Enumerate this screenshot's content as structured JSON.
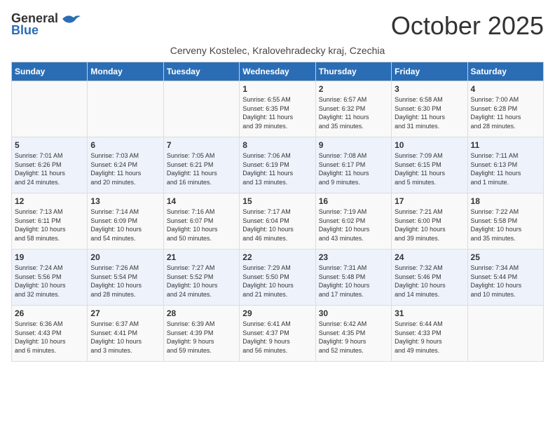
{
  "logo": {
    "general": "General",
    "blue": "Blue"
  },
  "title": "October 2025",
  "subtitle": "Cerveny Kostelec, Kralovehradecky kraj, Czechia",
  "days_of_week": [
    "Sunday",
    "Monday",
    "Tuesday",
    "Wednesday",
    "Thursday",
    "Friday",
    "Saturday"
  ],
  "weeks": [
    [
      {
        "day": "",
        "detail": ""
      },
      {
        "day": "",
        "detail": ""
      },
      {
        "day": "",
        "detail": ""
      },
      {
        "day": "1",
        "detail": "Sunrise: 6:55 AM\nSunset: 6:35 PM\nDaylight: 11 hours\nand 39 minutes."
      },
      {
        "day": "2",
        "detail": "Sunrise: 6:57 AM\nSunset: 6:32 PM\nDaylight: 11 hours\nand 35 minutes."
      },
      {
        "day": "3",
        "detail": "Sunrise: 6:58 AM\nSunset: 6:30 PM\nDaylight: 11 hours\nand 31 minutes."
      },
      {
        "day": "4",
        "detail": "Sunrise: 7:00 AM\nSunset: 6:28 PM\nDaylight: 11 hours\nand 28 minutes."
      }
    ],
    [
      {
        "day": "5",
        "detail": "Sunrise: 7:01 AM\nSunset: 6:26 PM\nDaylight: 11 hours\nand 24 minutes."
      },
      {
        "day": "6",
        "detail": "Sunrise: 7:03 AM\nSunset: 6:24 PM\nDaylight: 11 hours\nand 20 minutes."
      },
      {
        "day": "7",
        "detail": "Sunrise: 7:05 AM\nSunset: 6:21 PM\nDaylight: 11 hours\nand 16 minutes."
      },
      {
        "day": "8",
        "detail": "Sunrise: 7:06 AM\nSunset: 6:19 PM\nDaylight: 11 hours\nand 13 minutes."
      },
      {
        "day": "9",
        "detail": "Sunrise: 7:08 AM\nSunset: 6:17 PM\nDaylight: 11 hours\nand 9 minutes."
      },
      {
        "day": "10",
        "detail": "Sunrise: 7:09 AM\nSunset: 6:15 PM\nDaylight: 11 hours\nand 5 minutes."
      },
      {
        "day": "11",
        "detail": "Sunrise: 7:11 AM\nSunset: 6:13 PM\nDaylight: 11 hours\nand 1 minute."
      }
    ],
    [
      {
        "day": "12",
        "detail": "Sunrise: 7:13 AM\nSunset: 6:11 PM\nDaylight: 10 hours\nand 58 minutes."
      },
      {
        "day": "13",
        "detail": "Sunrise: 7:14 AM\nSunset: 6:09 PM\nDaylight: 10 hours\nand 54 minutes."
      },
      {
        "day": "14",
        "detail": "Sunrise: 7:16 AM\nSunset: 6:07 PM\nDaylight: 10 hours\nand 50 minutes."
      },
      {
        "day": "15",
        "detail": "Sunrise: 7:17 AM\nSunset: 6:04 PM\nDaylight: 10 hours\nand 46 minutes."
      },
      {
        "day": "16",
        "detail": "Sunrise: 7:19 AM\nSunset: 6:02 PM\nDaylight: 10 hours\nand 43 minutes."
      },
      {
        "day": "17",
        "detail": "Sunrise: 7:21 AM\nSunset: 6:00 PM\nDaylight: 10 hours\nand 39 minutes."
      },
      {
        "day": "18",
        "detail": "Sunrise: 7:22 AM\nSunset: 5:58 PM\nDaylight: 10 hours\nand 35 minutes."
      }
    ],
    [
      {
        "day": "19",
        "detail": "Sunrise: 7:24 AM\nSunset: 5:56 PM\nDaylight: 10 hours\nand 32 minutes."
      },
      {
        "day": "20",
        "detail": "Sunrise: 7:26 AM\nSunset: 5:54 PM\nDaylight: 10 hours\nand 28 minutes."
      },
      {
        "day": "21",
        "detail": "Sunrise: 7:27 AM\nSunset: 5:52 PM\nDaylight: 10 hours\nand 24 minutes."
      },
      {
        "day": "22",
        "detail": "Sunrise: 7:29 AM\nSunset: 5:50 PM\nDaylight: 10 hours\nand 21 minutes."
      },
      {
        "day": "23",
        "detail": "Sunrise: 7:31 AM\nSunset: 5:48 PM\nDaylight: 10 hours\nand 17 minutes."
      },
      {
        "day": "24",
        "detail": "Sunrise: 7:32 AM\nSunset: 5:46 PM\nDaylight: 10 hours\nand 14 minutes."
      },
      {
        "day": "25",
        "detail": "Sunrise: 7:34 AM\nSunset: 5:44 PM\nDaylight: 10 hours\nand 10 minutes."
      }
    ],
    [
      {
        "day": "26",
        "detail": "Sunrise: 6:36 AM\nSunset: 4:43 PM\nDaylight: 10 hours\nand 6 minutes."
      },
      {
        "day": "27",
        "detail": "Sunrise: 6:37 AM\nSunset: 4:41 PM\nDaylight: 10 hours\nand 3 minutes."
      },
      {
        "day": "28",
        "detail": "Sunrise: 6:39 AM\nSunset: 4:39 PM\nDaylight: 9 hours\nand 59 minutes."
      },
      {
        "day": "29",
        "detail": "Sunrise: 6:41 AM\nSunset: 4:37 PM\nDaylight: 9 hours\nand 56 minutes."
      },
      {
        "day": "30",
        "detail": "Sunrise: 6:42 AM\nSunset: 4:35 PM\nDaylight: 9 hours\nand 52 minutes."
      },
      {
        "day": "31",
        "detail": "Sunrise: 6:44 AM\nSunset: 4:33 PM\nDaylight: 9 hours\nand 49 minutes."
      },
      {
        "day": "",
        "detail": ""
      }
    ]
  ]
}
